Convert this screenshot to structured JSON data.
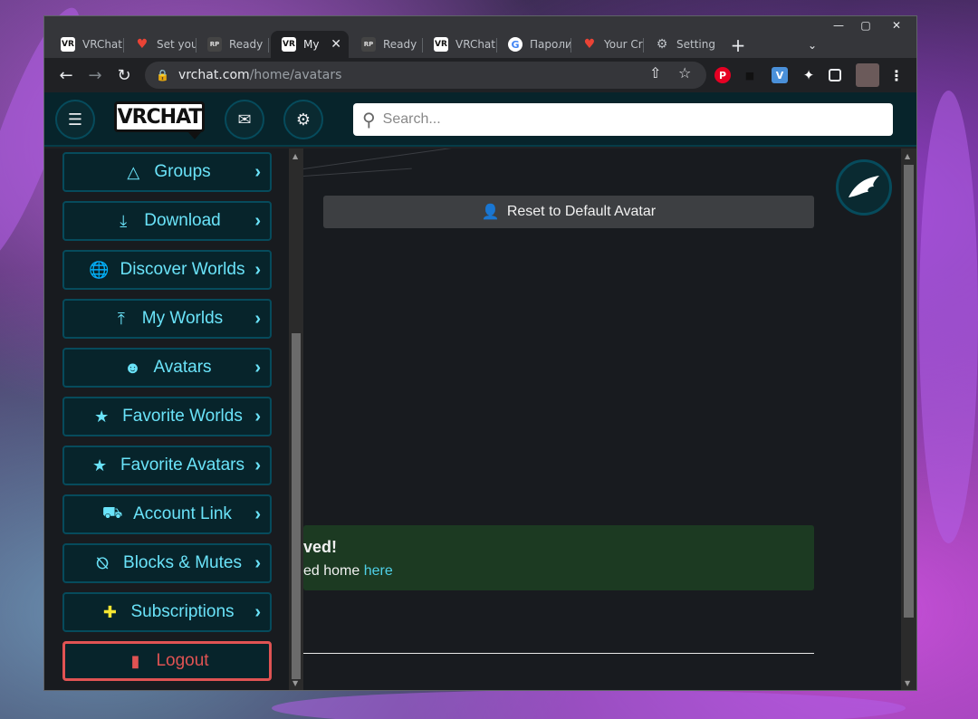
{
  "browser": {
    "tabs": [
      {
        "label": "VRChat",
        "favicon": "vrchat-icon",
        "active": false
      },
      {
        "label": "Set you",
        "favicon": "gmail-icon",
        "active": false
      },
      {
        "label": "Ready",
        "favicon": "readyplayerme-icon",
        "active": false
      },
      {
        "label": "My",
        "favicon": "vrchat-icon",
        "active": true
      },
      {
        "label": "Ready",
        "favicon": "readyplayerme-icon",
        "active": false
      },
      {
        "label": "VRChat",
        "favicon": "vrchat-icon",
        "active": false
      },
      {
        "label": "Пароли",
        "favicon": "google-icon",
        "active": false
      },
      {
        "label": "Your Cr",
        "favicon": "gmail-icon",
        "active": false
      },
      {
        "label": "Setting",
        "favicon": "gear-icon",
        "active": false
      }
    ],
    "url_host": "vrchat.com",
    "url_path": "/home/avatars",
    "colors": {
      "chrome_bg": "#35363a",
      "active_tab_bg": "#202124"
    }
  },
  "header": {
    "logo_text": "VRCHAT",
    "search_placeholder": "Search..."
  },
  "sidebar": {
    "items": [
      {
        "label": "Groups",
        "icon": "groups-icon"
      },
      {
        "label": "Download",
        "icon": "download-icon"
      },
      {
        "label": "Discover Worlds",
        "icon": "globe-icon"
      },
      {
        "label": "My Worlds",
        "icon": "upload-icon"
      },
      {
        "label": "Avatars",
        "icon": "avatar-icon"
      },
      {
        "label": "Favorite Worlds",
        "icon": "star-icon"
      },
      {
        "label": "Favorite Avatars",
        "icon": "star-icon"
      },
      {
        "label": "Account Link",
        "icon": "truck-icon"
      },
      {
        "label": "Blocks & Mutes",
        "icon": "mute-icon"
      },
      {
        "label": "Subscriptions",
        "icon": "subscription-icon"
      }
    ],
    "logout_label": "Logout",
    "colors": {
      "accent": "#6ae3f9",
      "item_bg": "#07242b",
      "item_border": "#064b5c",
      "logout": "#e05353"
    }
  },
  "main": {
    "reset_button_label": "Reset to Default Avatar",
    "alert": {
      "title_fragment": "ved!",
      "body_fragment": "ed home",
      "link_text": "here",
      "bg_color": "#1c3a22"
    }
  }
}
